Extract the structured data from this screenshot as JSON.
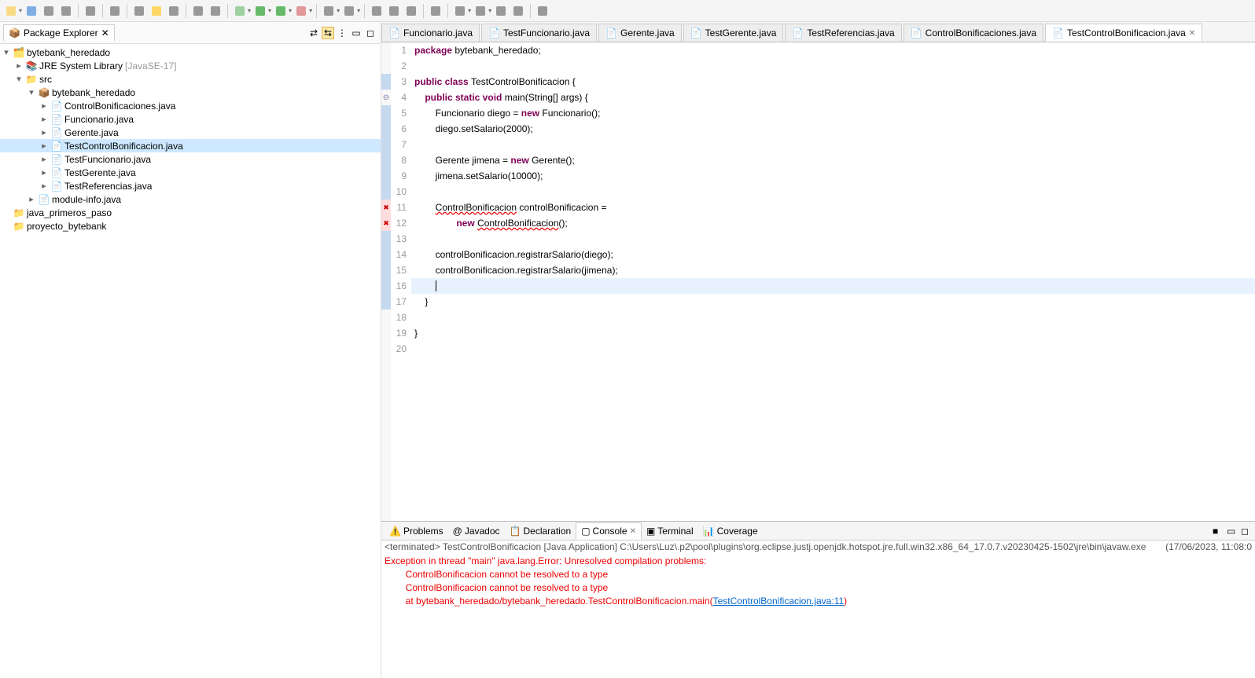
{
  "toolbar_icons": [
    "new",
    "save",
    "saveall",
    "print",
    "sep",
    "perspective",
    "sep",
    "breakpoint",
    "sep",
    "pin",
    "highlight",
    "bookmark",
    "sep",
    "stepover",
    "skip",
    "sep",
    "debug",
    "run",
    "coverage",
    "external",
    "sep",
    "newpkg",
    "newclass",
    "sep",
    "folder",
    "search",
    "tasks",
    "sep",
    "syncclass",
    "sep",
    "back",
    "forward",
    "up",
    "refresh",
    "sep",
    "launch"
  ],
  "explorer": {
    "title": "Package Explorer",
    "project": "bytebank_heredado",
    "jre": "JRE System Library",
    "jre_ver": "[JavaSE-17]",
    "src": "src",
    "pkg": "bytebank_heredado",
    "files": [
      "ControlBonificaciones.java",
      "Funcionario.java",
      "Gerente.java",
      "TestControlBonificacion.java",
      "TestFuncionario.java",
      "TestGerente.java",
      "TestReferencias.java"
    ],
    "selected_file": "TestControlBonificacion.java",
    "module": "module-info.java",
    "closed": [
      "java_primeros_paso",
      "proyecto_bytebank"
    ]
  },
  "editor_tabs": [
    "Funcionario.java",
    "TestFuncionario.java",
    "Gerente.java",
    "TestGerente.java",
    "TestReferencias.java",
    "ControlBonificaciones.java",
    "TestControlBonificacion.java"
  ],
  "active_tab": "TestControlBonificacion.java",
  "code": {
    "lines": 20,
    "current_line": 16,
    "l1": "package bytebank_heredado;",
    "l3a": "public class ",
    "l3b": "TestControlBonificacion {",
    "l4a": "    public static void ",
    "l4b": "main(String[] args) {",
    "l5a": "        Funcionario diego = ",
    "l5b": "new",
    "l5c": " Funcionario();",
    "l6": "        diego.setSalario(2000);",
    "l8a": "        Gerente jimena = ",
    "l8b": "new",
    "l8c": " Gerente();",
    "l9": "        jimena.setSalario(10000);",
    "l11a": "        ",
    "l11b": "ControlBonificacion",
    "l11c": " controlBonificacion =",
    "l12a": "                ",
    "l12b": "new",
    "l12c": " ",
    "l12d": "ControlBonificacion",
    "l12e": "();",
    "l14": "        controlBonificacion.registrarSalario(diego);",
    "l15": "        controlBonificacion.registrarSalario(jimena);",
    "l16": "        ",
    "l17": "    }",
    "l19": "}"
  },
  "bottom_tabs": [
    "Problems",
    "Javadoc",
    "Declaration",
    "Console",
    "Terminal",
    "Coverage"
  ],
  "active_bottom": "Console",
  "console_status_pre": "<terminated> TestControlBonificacion [Java Application] C:\\Users\\Luz\\.p2\\pool\\plugins\\org.eclipse.justj.openjdk.hotspot.jre.full.win32.x86_64_17.0.7.v20230425-1502\\jre\\bin\\javaw.exe",
  "console_ts": "(17/06/2023, 11:08:0",
  "console_lines": [
    "Exception in thread \"main\" java.lang.Error: Unresolved compilation problems: ",
    "        ControlBonificacion cannot be resolved to a type",
    "        ControlBonificacion cannot be resolved to a type",
    "",
    "        at bytebank_heredado/bytebank_heredado.TestControlBonificacion.main("
  ],
  "console_link": "TestControlBonificacion.java:11",
  "console_tail": ")"
}
